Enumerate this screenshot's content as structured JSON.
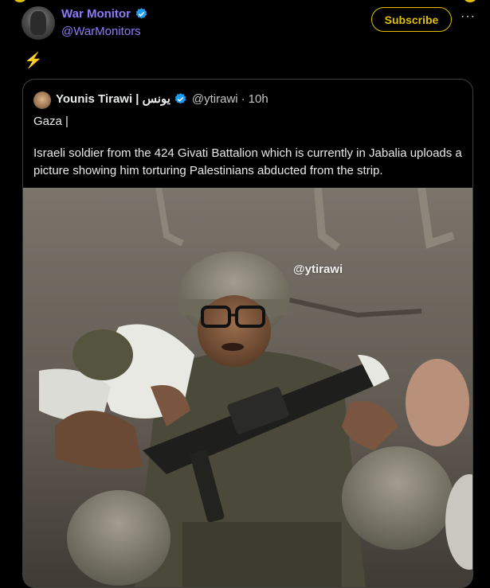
{
  "colors": {
    "accent_yellow": "#e0c000",
    "name_purple": "#8b7cf7",
    "verified_blue": "#1d9bf0",
    "text": "#e7e9ea",
    "muted": "#c5c6c8",
    "border": "#3d3f42"
  },
  "post": {
    "author_name": "War Monitor",
    "author_handle": "@WarMonitors",
    "subscribe_label": "Subscribe",
    "more_label": "···",
    "body_emoji": "⚡",
    "verified_icon": "verified-badge-icon"
  },
  "quoted": {
    "author_name": "Younis Tirawi | يونس",
    "author_handle": "@ytirawi",
    "separator": "·",
    "time": "10h",
    "text_line1": "Gaza |",
    "text_line2": "Israeli soldier from the 424 Givati Battalion which is currently in Jabalia uploads a picture showing him torturing Palestinians abducted from the strip.",
    "image_watermark": "@ytirawi"
  }
}
